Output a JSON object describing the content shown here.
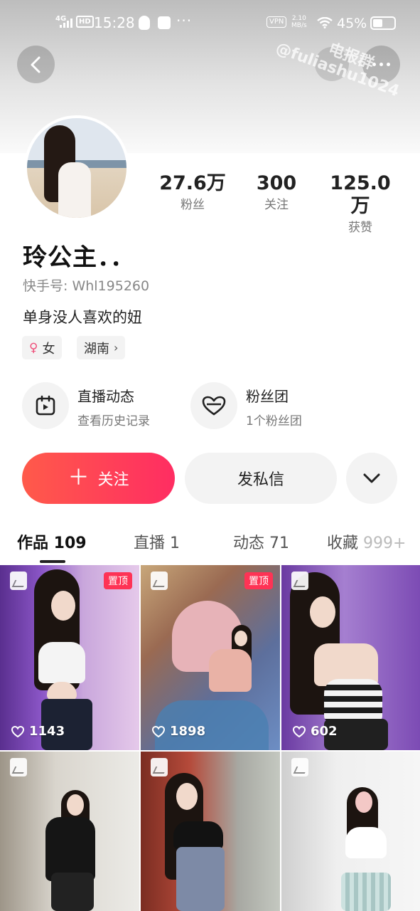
{
  "status_bar": {
    "network": "4G",
    "hd": "HD",
    "time": "15:28",
    "more": "···",
    "vpn": "VPN",
    "speed_value": "2.10",
    "speed_unit": "MB/s",
    "battery_pct": "45%",
    "battery_level": 0.45
  },
  "watermark": {
    "line1": "电报群",
    "line2": "@fuliashu1024"
  },
  "profile": {
    "name": "玲公主．．",
    "kuaishou_id": "快手号: Whl195260",
    "bio": "单身没人喜欢的妞",
    "gender": "女",
    "location": "湖南"
  },
  "stats": [
    {
      "value": "27.6万",
      "label": "粉丝"
    },
    {
      "value": "300",
      "label": "关注"
    },
    {
      "value": "125.0万",
      "label": "获赞"
    }
  ],
  "features": [
    {
      "title": "直播动态",
      "subtitle": "查看历史记录",
      "icon": "calendar-play-icon"
    },
    {
      "title": "粉丝团",
      "subtitle": "1个粉丝团",
      "icon": "heart-badge-icon"
    }
  ],
  "actions": {
    "follow": "关注",
    "message": "发私信",
    "dropdown_icon": "chevron-down-icon"
  },
  "tabs": [
    {
      "label": "作品 109",
      "active": true
    },
    {
      "label": "直播 1",
      "active": false
    },
    {
      "label": "动态 71",
      "active": false
    },
    {
      "label": "收藏 ",
      "count": "999+",
      "active": false
    }
  ],
  "posts": [
    {
      "likes": "1143",
      "pinned": "置顶"
    },
    {
      "likes": "1898",
      "pinned": "置顶"
    },
    {
      "likes": "602",
      "pinned": ""
    },
    {
      "likes": "",
      "pinned": ""
    },
    {
      "likes": "",
      "pinned": ""
    },
    {
      "likes": "",
      "pinned": ""
    }
  ],
  "colors": {
    "accent": "#fe2c55",
    "follow_gradient_start": "#ff5a4a",
    "follow_gradient_end": "#ff2d62"
  }
}
